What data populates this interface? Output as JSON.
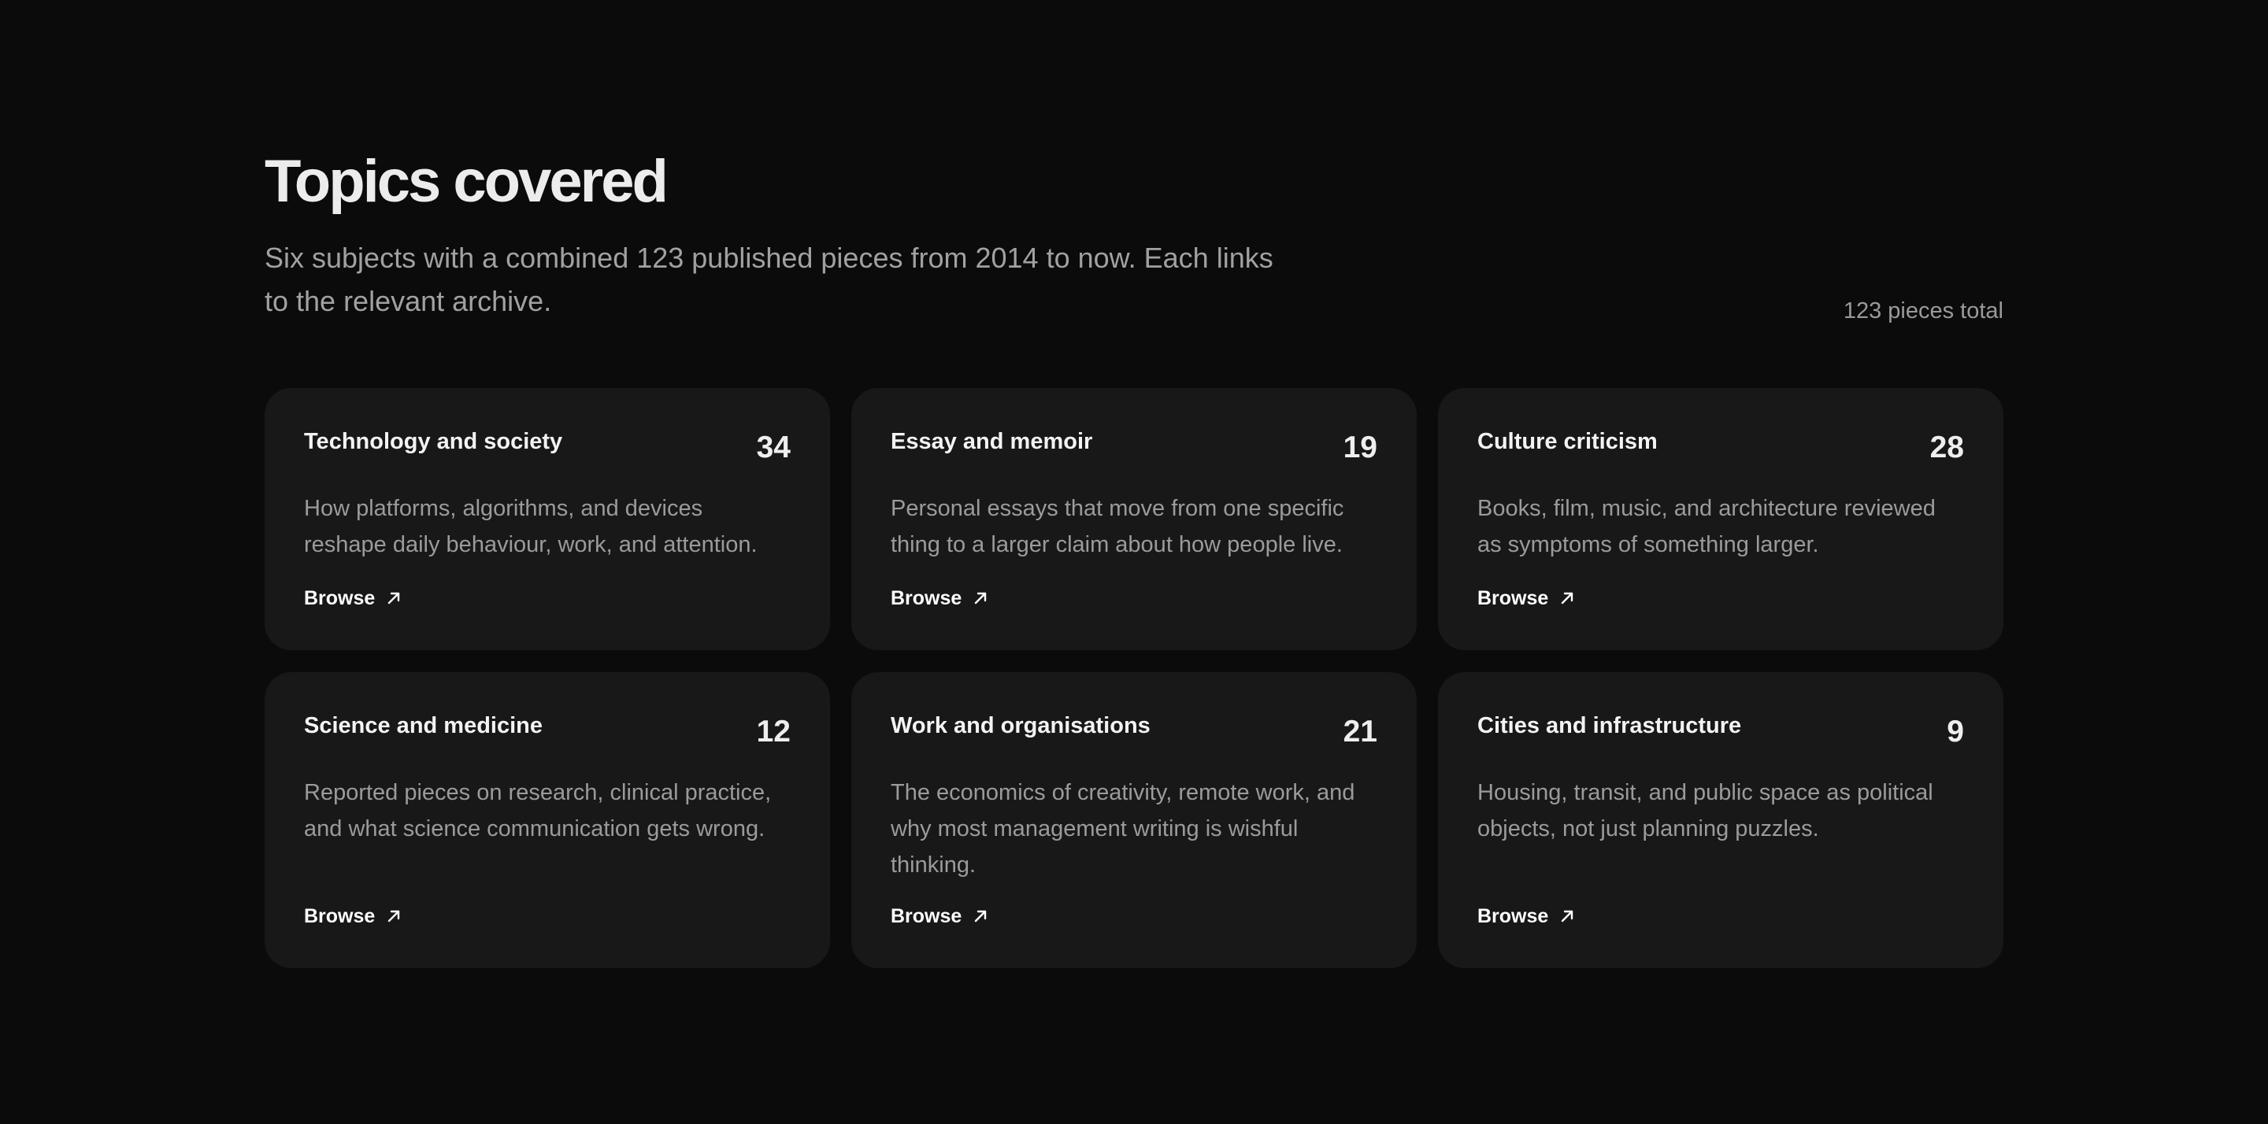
{
  "section": {
    "title": "Topics covered",
    "subtitle": "Six subjects with a combined 123 published pieces from 2014 to now. Each links to the relevant archive.",
    "total_label": "123 pieces total"
  },
  "topics": [
    {
      "title": "Technology and society",
      "count": "34",
      "description": "How platforms, algorithms, and devices reshape daily behaviour, work, and attention.",
      "link_label": "Browse",
      "link_icon": "arrow-up-right-icon"
    },
    {
      "title": "Essay and memoir",
      "count": "19",
      "description": "Personal essays that move from one specific thing to a larger claim about how people live.",
      "link_label": "Browse",
      "link_icon": "arrow-up-right-icon"
    },
    {
      "title": "Culture criticism",
      "count": "28",
      "description": "Books, film, music, and architecture reviewed as symptoms of something larger.",
      "link_label": "Browse",
      "link_icon": "arrow-up-right-icon"
    },
    {
      "title": "Science and medicine",
      "count": "12",
      "description": "Reported pieces on research, clinical practice, and what science communication gets wrong.",
      "link_label": "Browse",
      "link_icon": "arrow-up-right-icon"
    },
    {
      "title": "Work and organisations",
      "count": "21",
      "description": "The economics of creativity, remote work, and why most management writing is wishful thinking.",
      "link_label": "Browse",
      "link_icon": "arrow-up-right-icon"
    },
    {
      "title": "Cities and infrastructure",
      "count": "9",
      "description": "Housing, transit, and public space as political objects, not just planning puzzles.",
      "link_label": "Browse",
      "link_icon": "arrow-up-right-icon"
    }
  ],
  "colors": {
    "background": "#0b0b0b",
    "card": "#181818",
    "text_primary": "#ededed",
    "text_secondary": "#9b9b9b"
  }
}
